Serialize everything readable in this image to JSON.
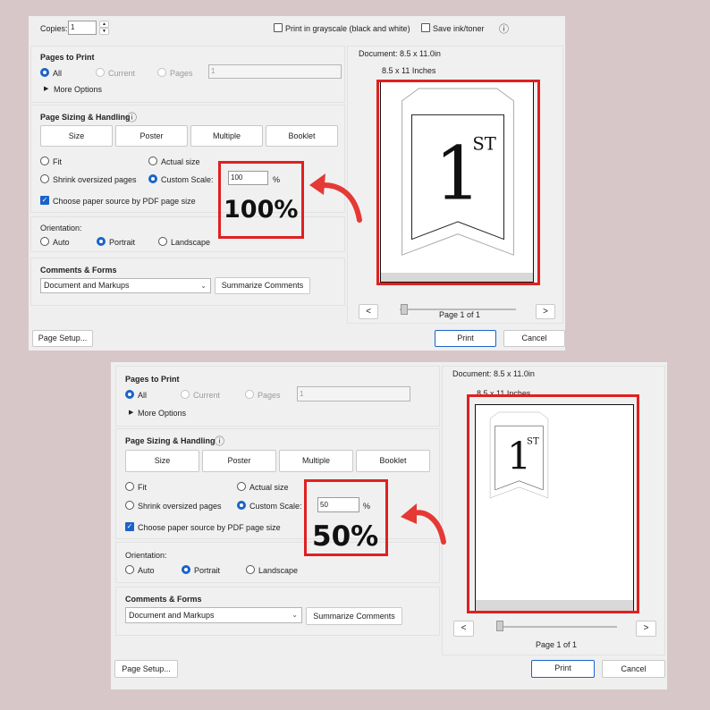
{
  "dialog1": {
    "copies_label": "Copies:",
    "copies_value": "1",
    "grayscale_label": "Print in grayscale (black and white)",
    "save_ink_label": "Save ink/toner",
    "info_icon": "info-icon",
    "pages_to_print": {
      "title": "Pages to Print",
      "all": "All",
      "current": "Current",
      "pages": "Pages",
      "pages_value": "1",
      "more_options": "More Options"
    },
    "sizing": {
      "title": "Page Sizing & Handling",
      "tabs": [
        "Size",
        "Poster",
        "Multiple",
        "Booklet"
      ],
      "fit": "Fit",
      "actual_size": "Actual size",
      "shrink": "Shrink oversized pages",
      "custom_scale": "Custom Scale:",
      "scale_value": "100",
      "percent_sign": "%",
      "choose_paper": "Choose paper source by PDF page size"
    },
    "annotation": "100%",
    "orientation": {
      "title": "Orientation:",
      "auto": "Auto",
      "portrait": "Portrait",
      "landscape": "Landscape"
    },
    "comments": {
      "title": "Comments & Forms",
      "select_value": "Document and Markups",
      "summarize": "Summarize Comments"
    },
    "preview": {
      "document_size": "Document: 8.5 x 11.0in",
      "paper_size": "8.5 x 11 Inches",
      "big_text": "1",
      "superscript": "ST",
      "prev": "<",
      "next": ">",
      "page_info": "Page 1 of 1",
      "scale": 1.0
    },
    "page_setup": "Page Setup...",
    "print": "Print",
    "cancel": "Cancel"
  },
  "dialog2": {
    "pages_to_print": {
      "title": "Pages to Print",
      "all": "All",
      "current": "Current",
      "pages": "Pages",
      "pages_value": "1",
      "more_options": "More Options"
    },
    "sizing": {
      "title": "Page Sizing & Handling",
      "tabs": [
        "Size",
        "Poster",
        "Multiple",
        "Booklet"
      ],
      "fit": "Fit",
      "actual_size": "Actual size",
      "shrink": "Shrink oversized pages",
      "custom_scale": "Custom Scale:",
      "scale_value": "50",
      "percent_sign": "%",
      "choose_paper": "Choose paper source by PDF page size"
    },
    "annotation": "50%",
    "orientation": {
      "title": "Orientation:",
      "auto": "Auto",
      "portrait": "Portrait",
      "landscape": "Landscape"
    },
    "comments": {
      "title": "Comments & Forms",
      "select_value": "Document and Markups",
      "summarize": "Summarize Comments"
    },
    "preview": {
      "document_size": "Document: 8.5 x 11.0in",
      "paper_size": "8.5 x 11 Inches",
      "big_text": "1",
      "superscript": "ST",
      "prev": "<",
      "next": ">",
      "page_info": "Page 1 of 1",
      "scale": 0.5
    },
    "page_setup": "Page Setup...",
    "print": "Print",
    "cancel": "Cancel"
  },
  "colors": {
    "background": "#d8c7c9",
    "highlight_red": "#e02020",
    "accent_blue": "#1a63c9"
  }
}
